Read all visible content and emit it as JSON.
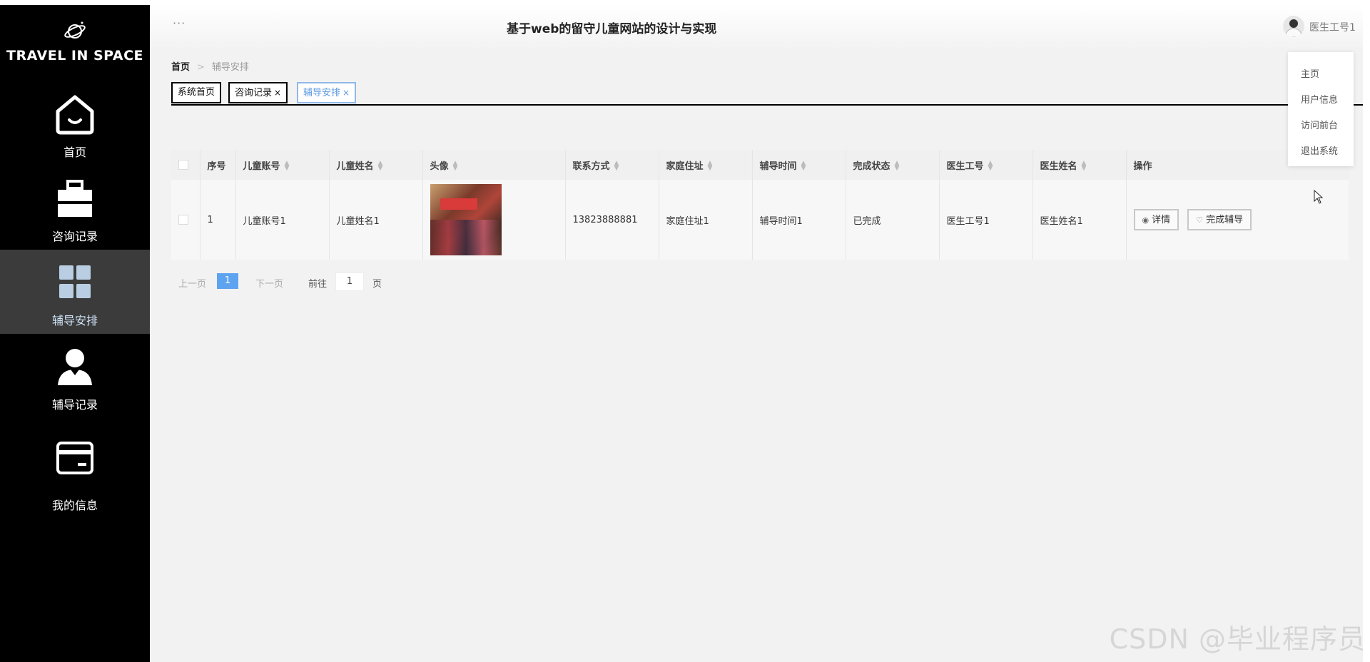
{
  "app": {
    "logo_text": "TRAVEL IN SPACE",
    "title": "基于web的留守儿童网站的设计与实现"
  },
  "header": {
    "dots": "···",
    "user_name": "医生工号1"
  },
  "sidebar": {
    "items": [
      {
        "label": "首页",
        "icon": "home-icon"
      },
      {
        "label": "咨询记录",
        "icon": "briefcase-icon"
      },
      {
        "label": "辅导安排",
        "icon": "grid-icon",
        "active": true
      },
      {
        "label": "辅导记录",
        "icon": "user-icon"
      },
      {
        "label": "我的信息",
        "icon": "card-icon"
      }
    ]
  },
  "breadcrumb": {
    "home": "首页",
    "sep": ">",
    "current": "辅导安排"
  },
  "tabs": [
    {
      "label": "系统首页",
      "closable": false
    },
    {
      "label": "咨询记录",
      "closable": true
    },
    {
      "label": "辅导安排",
      "closable": true,
      "active": true
    }
  ],
  "tab_close_glyph": "×",
  "table": {
    "columns": [
      "序号",
      "儿童账号",
      "儿童姓名",
      "头像",
      "联系方式",
      "家庭住址",
      "辅导时间",
      "完成状态",
      "医生工号",
      "医生姓名",
      "操作"
    ],
    "rows": [
      {
        "index": "1",
        "child_account": "儿童账号1",
        "child_name": "儿童姓名1",
        "phone": "13823888881",
        "address": "家庭住址1",
        "time": "辅导时间1",
        "status": "已完成",
        "doctor_id": "医生工号1",
        "doctor_name": "医生姓名1"
      }
    ],
    "actions": {
      "detail": "详情",
      "complete": "完成辅导"
    }
  },
  "pagination": {
    "prev": "上一页",
    "current": "1",
    "next": "下一页",
    "goto": "前往",
    "goto_value": "1",
    "unit": "页"
  },
  "dropdown": {
    "items": [
      "主页",
      "用户信息",
      "访问前台",
      "退出系统"
    ]
  },
  "watermark": "CSDN @毕业程序员",
  "colors": {
    "sidebar_bg": "#000000",
    "active_item_bg": "#3b3b3b",
    "accent": "#5ea3f0",
    "content_bg": "#f2f2f2"
  }
}
